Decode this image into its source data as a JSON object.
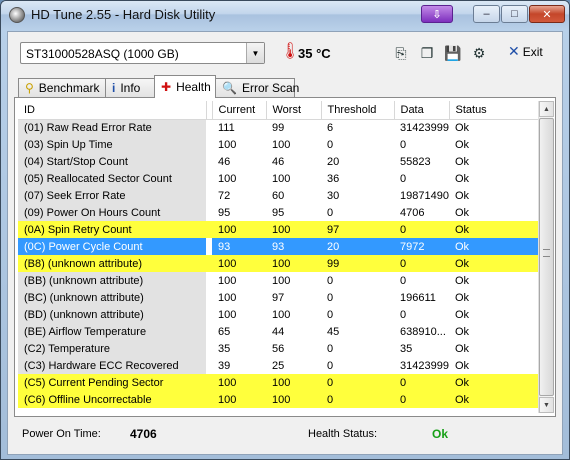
{
  "window": {
    "title": "HD Tune 2.55 - Hard Disk Utility",
    "buttons": {
      "update": "⇩",
      "minimize": "–",
      "maximize": "□",
      "close": "✕"
    }
  },
  "toolbar": {
    "drive": "ST31000528ASQ (1000 GB)",
    "temperature": "35 °C",
    "exit_label": "Exit",
    "icons": [
      "copy-icon",
      "copy-screen-icon",
      "save-icon",
      "options-icon"
    ]
  },
  "tabs": [
    {
      "label": "Benchmark",
      "icon": "benchmark-icon"
    },
    {
      "label": "Info",
      "icon": "info-icon"
    },
    {
      "label": "Health",
      "icon": "health-cross-icon"
    },
    {
      "label": "Error Scan",
      "icon": "magnifier-icon"
    }
  ],
  "table": {
    "columns": [
      "ID",
      "Current",
      "Worst",
      "Threshold",
      "Data",
      "Status"
    ],
    "rows": [
      {
        "id": "(01) Raw Read Error Rate",
        "current": "111",
        "worst": "99",
        "threshold": "6",
        "data": "31423999",
        "status": "Ok",
        "highlight": ""
      },
      {
        "id": "(03) Spin Up Time",
        "current": "100",
        "worst": "100",
        "threshold": "0",
        "data": "0",
        "status": "Ok",
        "highlight": ""
      },
      {
        "id": "(04) Start/Stop Count",
        "current": "46",
        "worst": "46",
        "threshold": "20",
        "data": "55823",
        "status": "Ok",
        "highlight": ""
      },
      {
        "id": "(05) Reallocated Sector Count",
        "current": "100",
        "worst": "100",
        "threshold": "36",
        "data": "0",
        "status": "Ok",
        "highlight": ""
      },
      {
        "id": "(07) Seek Error Rate",
        "current": "72",
        "worst": "60",
        "threshold": "30",
        "data": "19871490",
        "status": "Ok",
        "highlight": ""
      },
      {
        "id": "(09) Power On Hours Count",
        "current": "95",
        "worst": "95",
        "threshold": "0",
        "data": "4706",
        "status": "Ok",
        "highlight": ""
      },
      {
        "id": "(0A) Spin Retry Count",
        "current": "100",
        "worst": "100",
        "threshold": "97",
        "data": "0",
        "status": "Ok",
        "highlight": "yellow"
      },
      {
        "id": "(0C) Power Cycle Count",
        "current": "93",
        "worst": "93",
        "threshold": "20",
        "data": "7972",
        "status": "Ok",
        "highlight": "blue"
      },
      {
        "id": "(B8) (unknown attribute)",
        "current": "100",
        "worst": "100",
        "threshold": "99",
        "data": "0",
        "status": "Ok",
        "highlight": "yellow"
      },
      {
        "id": "(BB) (unknown attribute)",
        "current": "100",
        "worst": "100",
        "threshold": "0",
        "data": "0",
        "status": "Ok",
        "highlight": ""
      },
      {
        "id": "(BC) (unknown attribute)",
        "current": "100",
        "worst": "97",
        "threshold": "0",
        "data": "196611",
        "status": "Ok",
        "highlight": ""
      },
      {
        "id": "(BD) (unknown attribute)",
        "current": "100",
        "worst": "100",
        "threshold": "0",
        "data": "0",
        "status": "Ok",
        "highlight": ""
      },
      {
        "id": "(BE) Airflow Temperature",
        "current": "65",
        "worst": "44",
        "threshold": "45",
        "data": "638910...",
        "status": "Ok",
        "highlight": ""
      },
      {
        "id": "(C2) Temperature",
        "current": "35",
        "worst": "56",
        "threshold": "0",
        "data": "35",
        "status": "Ok",
        "highlight": ""
      },
      {
        "id": "(C3) Hardware ECC Recovered",
        "current": "39",
        "worst": "25",
        "threshold": "0",
        "data": "31423999",
        "status": "Ok",
        "highlight": ""
      },
      {
        "id": "(C5) Current Pending Sector",
        "current": "100",
        "worst": "100",
        "threshold": "0",
        "data": "0",
        "status": "Ok",
        "highlight": "yellow"
      },
      {
        "id": "(C6) Offline Uncorrectable",
        "current": "100",
        "worst": "100",
        "threshold": "0",
        "data": "0",
        "status": "Ok",
        "highlight": "yellow"
      }
    ]
  },
  "status": {
    "power_on_label": "Power On Time:",
    "power_on_value": "4706",
    "health_label": "Health Status:",
    "health_value": "Ok"
  },
  "colors": {
    "highlight_yellow": "#ffff3c",
    "highlight_blue": "#3399ff",
    "health_ok": "#18a018"
  }
}
